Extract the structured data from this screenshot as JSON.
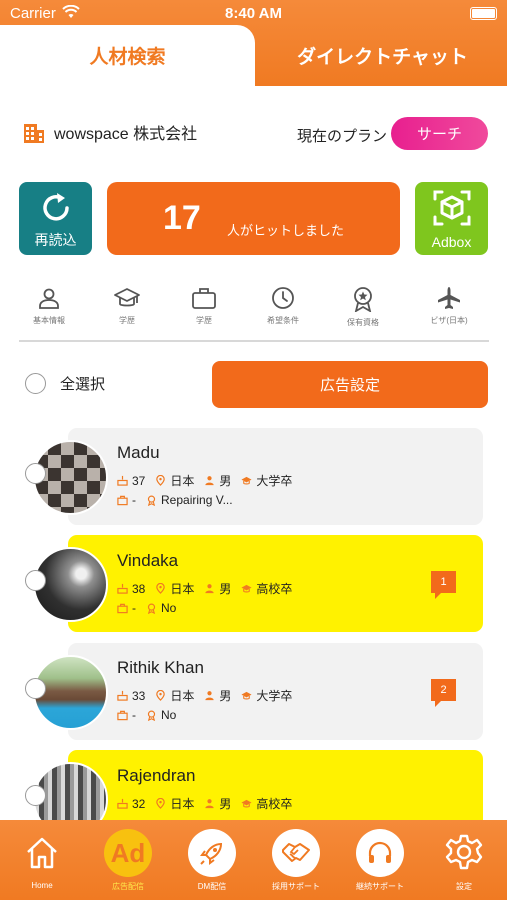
{
  "status": {
    "carrier": "Carrier",
    "time": "8:40 AM"
  },
  "tabs": {
    "search": "人材検索",
    "chat": "ダイレクトチャット"
  },
  "company": {
    "name": "wowspace 株式会社",
    "plan_label": "現在のプラン",
    "plan": "サーチ"
  },
  "actions": {
    "reload": "再読込",
    "hit_count": "17",
    "hit_text": "人がヒットしました",
    "adbox": "Adbox"
  },
  "filters": [
    {
      "label": "基本情報",
      "icon": "person-icon"
    },
    {
      "label": "学歴",
      "icon": "graduation-cap-icon"
    },
    {
      "label": "学歴",
      "icon": "briefcase-icon"
    },
    {
      "label": "希望条件",
      "icon": "clock-icon"
    },
    {
      "label": "保有資格",
      "icon": "award-icon"
    },
    {
      "label": "ビザ(日本)",
      "icon": "airplane-icon"
    }
  ],
  "select_all": "全選択",
  "ad_settings": "広告設定",
  "candidates": [
    {
      "name": "Madu",
      "age": "37",
      "location": "日本",
      "gender": "男",
      "education": "大学卒",
      "job": "-",
      "visa": "Repairing V...",
      "unread": ""
    },
    {
      "name": "Vindaka",
      "age": "38",
      "location": "日本",
      "gender": "男",
      "education": "高校卒",
      "job": "-",
      "visa": "No",
      "unread": "1"
    },
    {
      "name": "Rithik Khan",
      "age": "33",
      "location": "日本",
      "gender": "男",
      "education": "大学卒",
      "job": "-",
      "visa": "No",
      "unread": "2"
    },
    {
      "name": "Rajendran",
      "age": "32",
      "location": "日本",
      "gender": "男",
      "education": "高校卒",
      "job": "",
      "visa": "",
      "unread": ""
    }
  ],
  "nav": [
    {
      "label": "Home",
      "icon": "home-icon"
    },
    {
      "label": "広告配信",
      "icon": "ad-icon",
      "icon_text": "Ad"
    },
    {
      "label": "DM配信",
      "icon": "rocket-icon"
    },
    {
      "label": "採用サポート",
      "icon": "handshake-icon"
    },
    {
      "label": "継続サポート",
      "icon": "headphones-icon"
    },
    {
      "label": "設定",
      "icon": "gear-icon"
    }
  ],
  "colors": {
    "accent": "#f07a22",
    "reload": "#177f85",
    "adbox": "#7fc61e",
    "plan": "#e81f8f",
    "highlight": "#fff200"
  }
}
